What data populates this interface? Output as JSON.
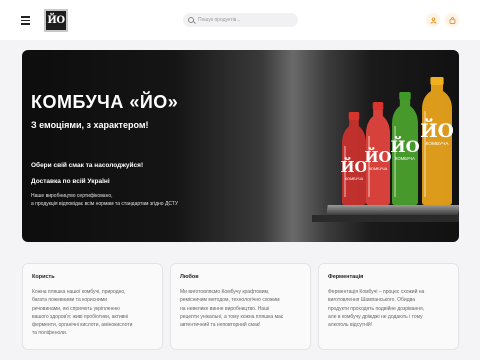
{
  "header": {
    "logo_text": "ЙО",
    "search_placeholder": "Пошук продуктів..."
  },
  "hero": {
    "title": "КОМБУЧА «ЙО»",
    "tagline": "З емоціями, з характером!",
    "choose": "Обери свій смак та насолоджуйся!",
    "delivery": "Доставка по всій Україні",
    "cert_line1": "Наше виробництво сертифіковано,",
    "cert_line2": "а продукція відповідає всім нормам та стандартам згідно ДСТУ",
    "bottle_label": "ЙО",
    "bottle_sub": "КОМБУЧА",
    "bottle_colors": [
      "#c8312e",
      "#e0443d",
      "#4aa02c",
      "#e8a21c"
    ],
    "cap_colors": [
      "#d8342c",
      "#d8342c",
      "#3f9a28",
      "#f0b020"
    ]
  },
  "cards": [
    {
      "title": "Користь",
      "lines": [
        "Кожна пляшка нашої комбучі, природно,",
        "багата пожевними та корисними",
        "речовинами, які сприяють укріпленню",
        "вашого здоров'я: живі пробіотики, активні",
        "ферменти, органічні кислоти, амінокислоти",
        "та поліфеноли."
      ]
    },
    {
      "title": "Любов",
      "lines": [
        "Ми виготовляємо Комбучу крафтовим,",
        "ремісничим методом, технологічно схожим",
        "на невелике винне виробництво. Наші",
        "рецепти унікальні, а тому кожна пляшка має",
        "автентичний та неповторний смак!"
      ]
    },
    {
      "title": "Ферментація",
      "lines": [
        "Ферментація Комбучі – процес схожий на",
        "виготовлення Шампанського. Обидва",
        "продукти проходять подвійне дозрівання,",
        "але в комбучу дріжджі не додають і тому",
        "алкоголь відсутній!"
      ]
    }
  ]
}
